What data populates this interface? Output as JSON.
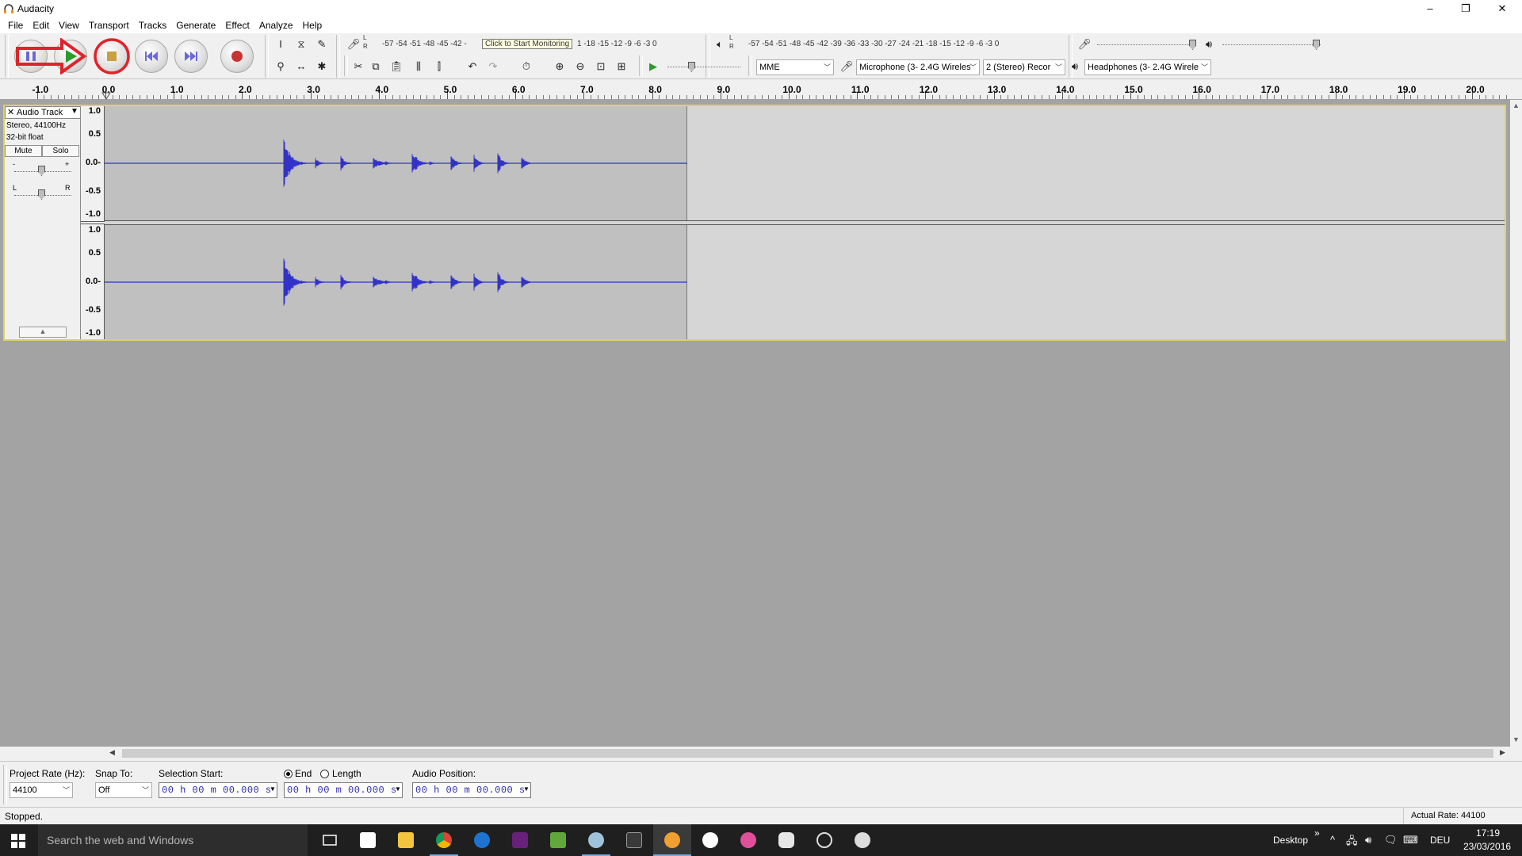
{
  "window": {
    "title": "Audacity",
    "minimize": "–",
    "restore": "❐",
    "close": "✕"
  },
  "menu": [
    "File",
    "Edit",
    "View",
    "Transport",
    "Tracks",
    "Generate",
    "Effect",
    "Analyze",
    "Help"
  ],
  "meters": {
    "record_scale": "-57 -54 -51 -48 -45 -42 -",
    "record_tooltip": "Click to Start Monitoring",
    "record_scale_right": "1 -18 -15 -12  -9  -6  -3  0",
    "play_scale": "-57 -54 -51 -48 -45 -42 -39 -36 -33 -30 -27 -24 -21 -18 -15 -12  -9  -6  -3  0",
    "lr_L": "L",
    "lr_R": "R"
  },
  "devices": {
    "host": "MME",
    "mic": "Microphone (3- 2.4G Wireles",
    "channels": "2 (Stereo) Recor",
    "output": "Headphones (3- 2.4G Wirele"
  },
  "ruler": {
    "labels": [
      "-1.0",
      "0.0",
      "1.0",
      "2.0",
      "3.0",
      "4.0",
      "5.0",
      "6.0",
      "7.0",
      "8.0",
      "9.0",
      "10.0",
      "11.0",
      "12.0",
      "13.0",
      "14.0",
      "15.0",
      "16.0",
      "17.0",
      "18.0",
      "19.0",
      "20.0"
    ]
  },
  "track": {
    "name": "Audio Track",
    "info1": "Stereo, 44100Hz",
    "info2": "32-bit float",
    "mute": "Mute",
    "solo": "Solo",
    "gain_minus": "-",
    "gain_plus": "+",
    "pan_l": "L",
    "pan_r": "R",
    "close": "✕",
    "menu_arrow": "▼",
    "collapse": "▲",
    "vruler": [
      "1.0",
      "0.5",
      "0.0-",
      "-0.5",
      "-1.0"
    ]
  },
  "selection_toolbar": {
    "project_rate_label": "Project Rate (Hz):",
    "project_rate_value": "44100",
    "snap_label": "Snap To:",
    "snap_value": "Off",
    "sel_start_label": "Selection Start:",
    "end_label": "End",
    "length_label": "Length",
    "audio_pos_label": "Audio Position:",
    "time_start": "00 h 00 m 00.000 s",
    "time_end": "00 h 00 m 00.000 s",
    "time_pos": "00 h 00 m 00.000 s"
  },
  "status": {
    "left": "Stopped.",
    "right": "Actual Rate: 44100"
  },
  "taskbar": {
    "search_placeholder": "Search the web and Windows",
    "desktop_label": "Desktop",
    "chevron": "»",
    "lang": "DEU",
    "time": "17:19",
    "date": "23/03/2016"
  },
  "colors": {
    "waveform": "#3232c8",
    "annotation_red": "#e0232a",
    "selection_border": "#d9d46a"
  }
}
